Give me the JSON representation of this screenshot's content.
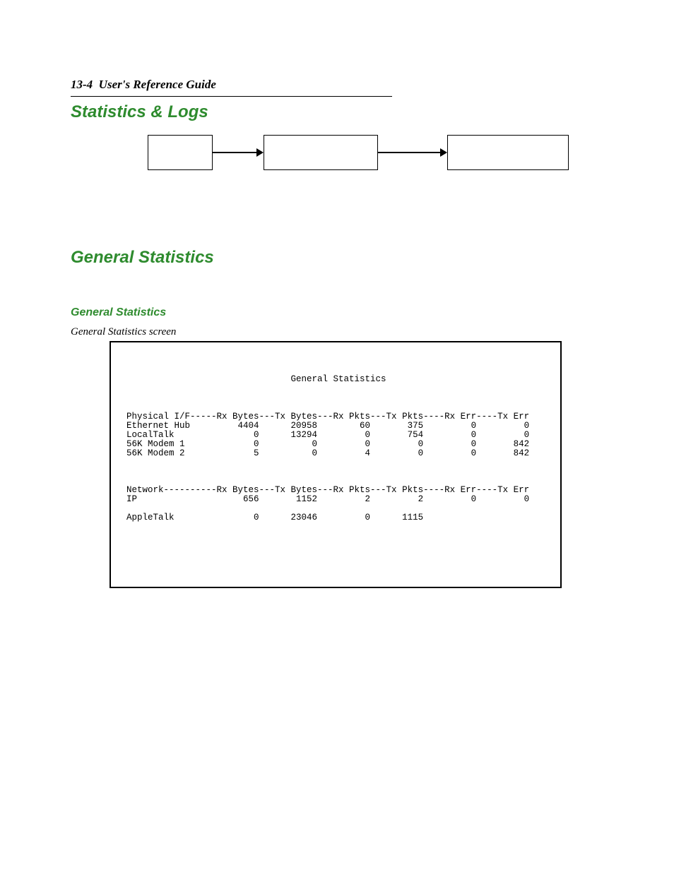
{
  "header": {
    "page_ref": "13-4",
    "guide_title": "User's Reference Guide"
  },
  "section_title": "Statistics & Logs",
  "subsection_title": "General Statistics",
  "sub_heading": "General Statistics",
  "caption": "General Statistics screen",
  "terminal": {
    "title": "General Statistics",
    "phys_header": "Physical I/F-----Rx Bytes---Tx Bytes---Rx Pkts---Tx Pkts----Rx Err----Tx Err",
    "phys_rows": [
      {
        "name": "Ethernet Hub",
        "rx_bytes": 4404,
        "tx_bytes": 20958,
        "rx_pkts": 60,
        "tx_pkts": 375,
        "rx_err": 0,
        "tx_err": 0
      },
      {
        "name": "LocalTalk",
        "rx_bytes": 0,
        "tx_bytes": 13294,
        "rx_pkts": 0,
        "tx_pkts": 754,
        "rx_err": 0,
        "tx_err": 0
      },
      {
        "name": "56K Modem 1",
        "rx_bytes": 0,
        "tx_bytes": 0,
        "rx_pkts": 0,
        "tx_pkts": 0,
        "rx_err": 0,
        "tx_err": 842
      },
      {
        "name": "56K Modem 2",
        "rx_bytes": 5,
        "tx_bytes": 0,
        "rx_pkts": 4,
        "tx_pkts": 0,
        "rx_err": 0,
        "tx_err": 842
      }
    ],
    "net_header": "Network----------Rx Bytes---Tx Bytes---Rx Pkts---Tx Pkts----Rx Err----Tx Err",
    "net_rows": [
      {
        "name": "IP",
        "rx_bytes": 656,
        "tx_bytes": 1152,
        "rx_pkts": 2,
        "tx_pkts": 2,
        "rx_err": 0,
        "tx_err": 0
      },
      {
        "name": "AppleTalk",
        "rx_bytes": 0,
        "tx_bytes": 23046,
        "rx_pkts": 0,
        "tx_pkts": 1115,
        "rx_err": null,
        "tx_err": null
      }
    ]
  }
}
